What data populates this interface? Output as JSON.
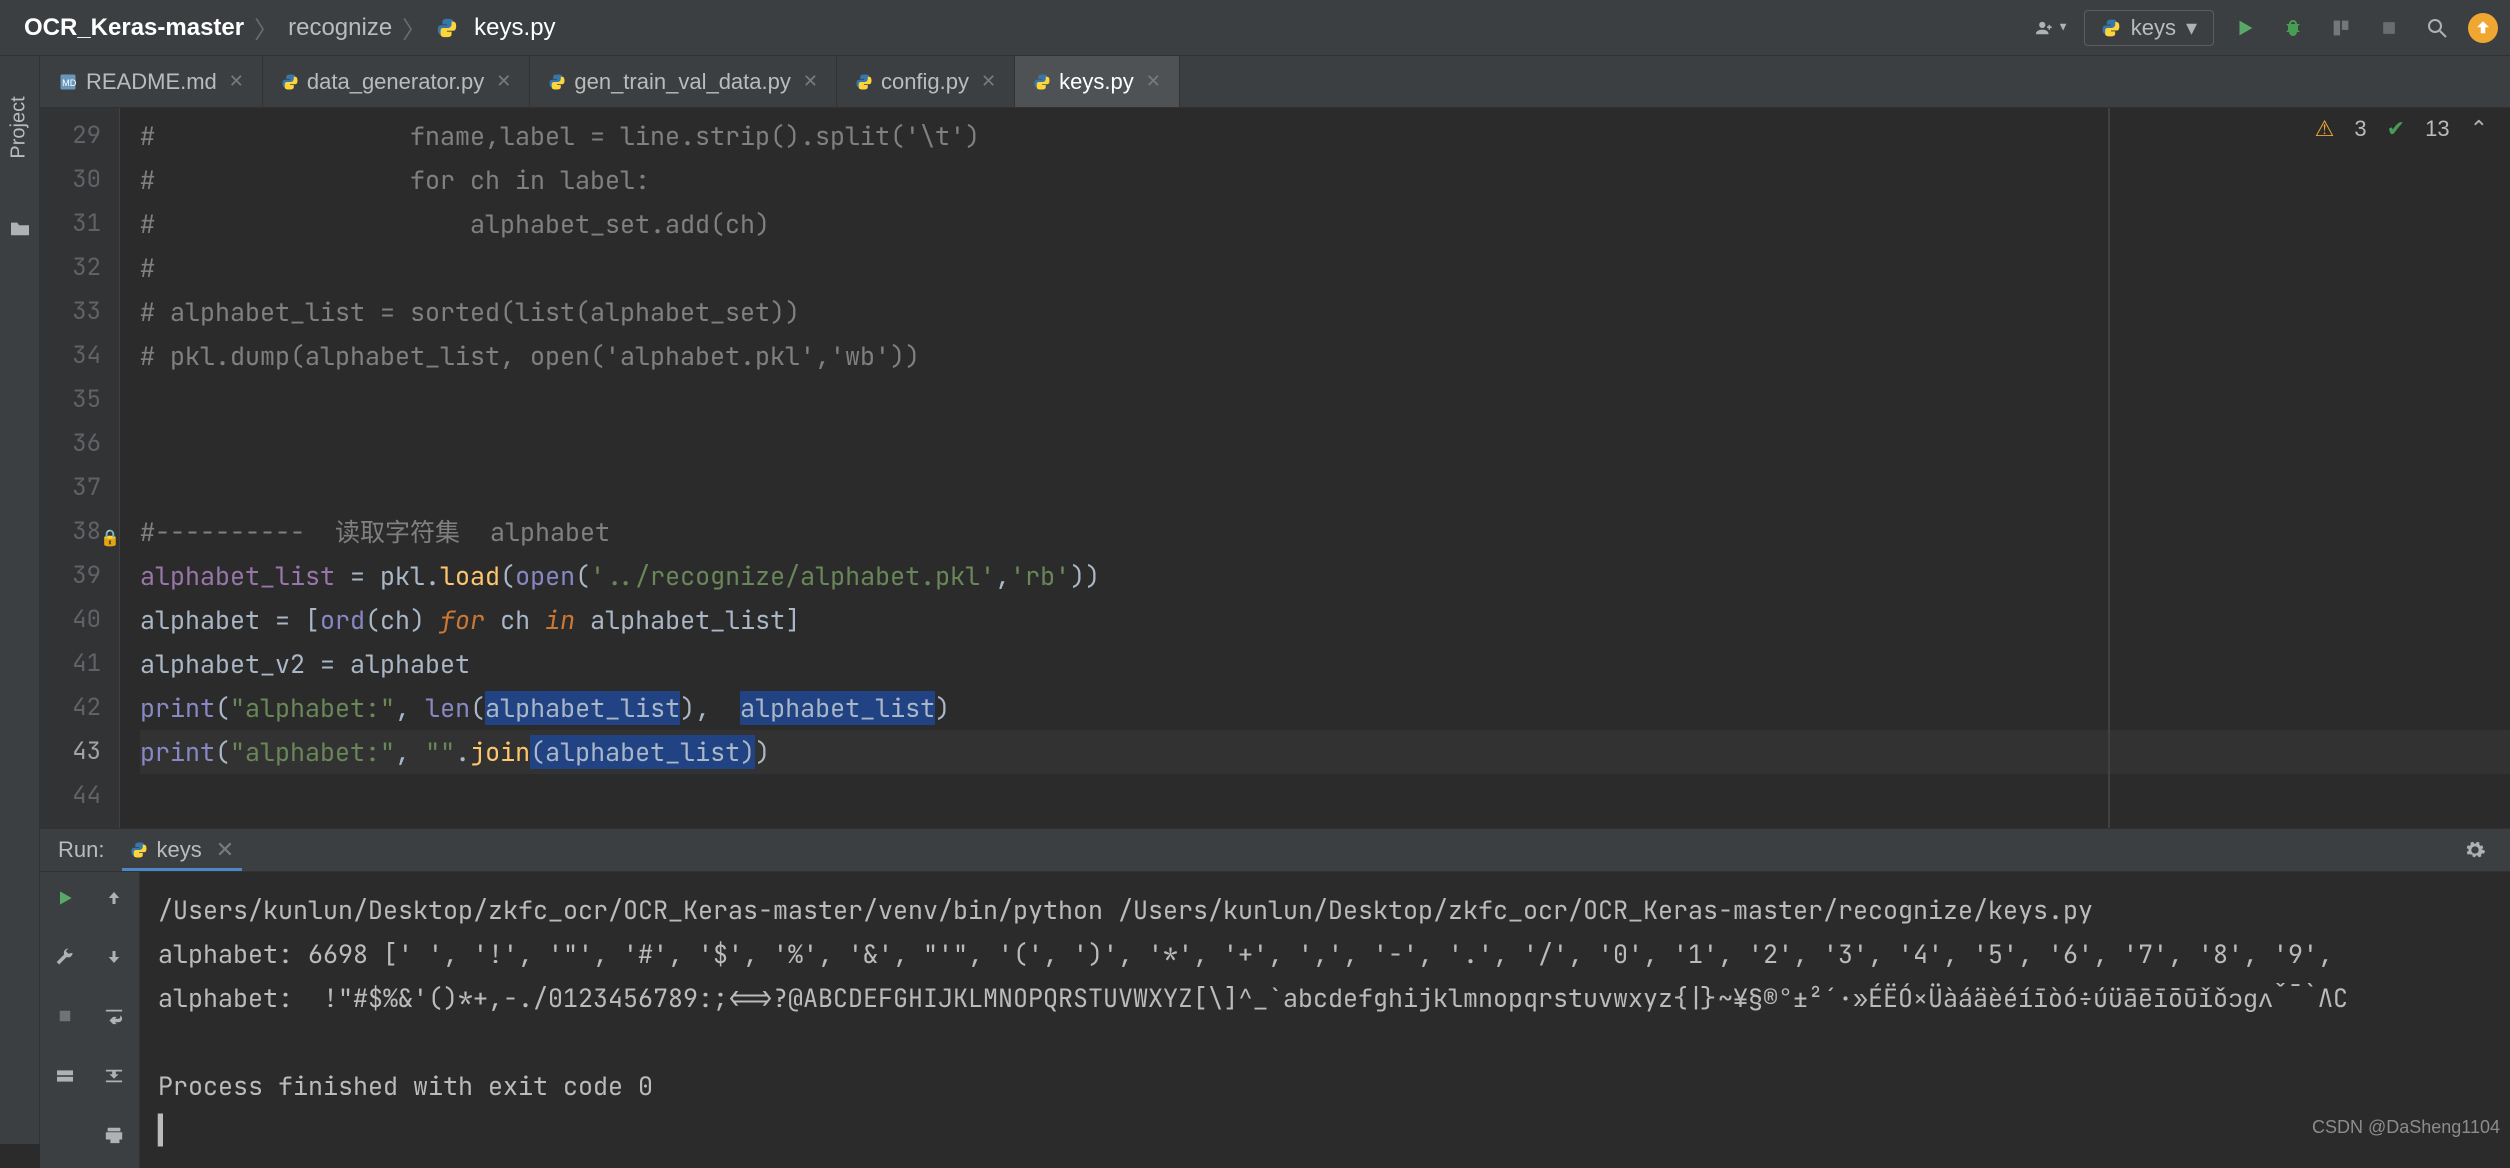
{
  "breadcrumb": {
    "root": "OCR_Keras-master",
    "mid": "recognize",
    "file": "keys.py"
  },
  "run_config": {
    "selected": "keys"
  },
  "tabs": [
    {
      "label": "README.md"
    },
    {
      "label": "data_generator.py"
    },
    {
      "label": "gen_train_val_data.py"
    },
    {
      "label": "config.py"
    },
    {
      "label": "keys.py"
    }
  ],
  "editor": {
    "first_line_no": 29,
    "lines": [
      "#                 fname,label = line.strip().split('\\t')",
      "#                 for ch in label:",
      "#                     alphabet_set.add(ch)",
      "#",
      "# alphabet_list = sorted(list(alphabet_set))",
      "# pkl.dump(alphabet_list, open('alphabet.pkl','wb'))",
      "",
      "",
      "",
      "#----------  读取字符集  alphabet",
      "alphabet_list = pkl.load(open('../recognize/alphabet.pkl','rb'))",
      "alphabet = [ord(ch) for ch in alphabet_list]",
      "alphabet_v2 = alphabet",
      "print(\"alphabet:\", len(alphabet_list), alphabet_list)",
      "print(\"alphabet:\", \"\".join(alphabet_list))",
      ""
    ],
    "current_line_index": 14
  },
  "inspection": {
    "warnings": "3",
    "weak": "13"
  },
  "run_panel": {
    "title": "Run:",
    "tab_label": "keys",
    "output": [
      "/Users/kunlun/Desktop/zkfc_ocr/OCR_Keras-master/venv/bin/python /Users/kunlun/Desktop/zkfc_ocr/OCR_Keras-master/recognize/keys.py",
      "alphabet: 6698 [' ', '!', '\"', '#', '$', '%', '&', \"'\", '(', ')', '*', '+', ',', '-', '.', '/', '0', '1', '2', '3', '4', '5', '6', '7', '8', '9',",
      "alphabet:  !\"#$%&'()*+,-./0123456789:;<=>?@ABCDEFGHIJKLMNOPQRSTUVWXYZ[\\]^_`abcdefghijklmnopqrstuvwxyz{|}~¥§®°±²´·»ÉËÓ×Üàáäèéíīòó÷úüāēīōūǐǒɔɡʌˇ¯`ΛС",
      "",
      "Process finished with exit code 0"
    ]
  },
  "watermark": "CSDN @DaSheng1104"
}
